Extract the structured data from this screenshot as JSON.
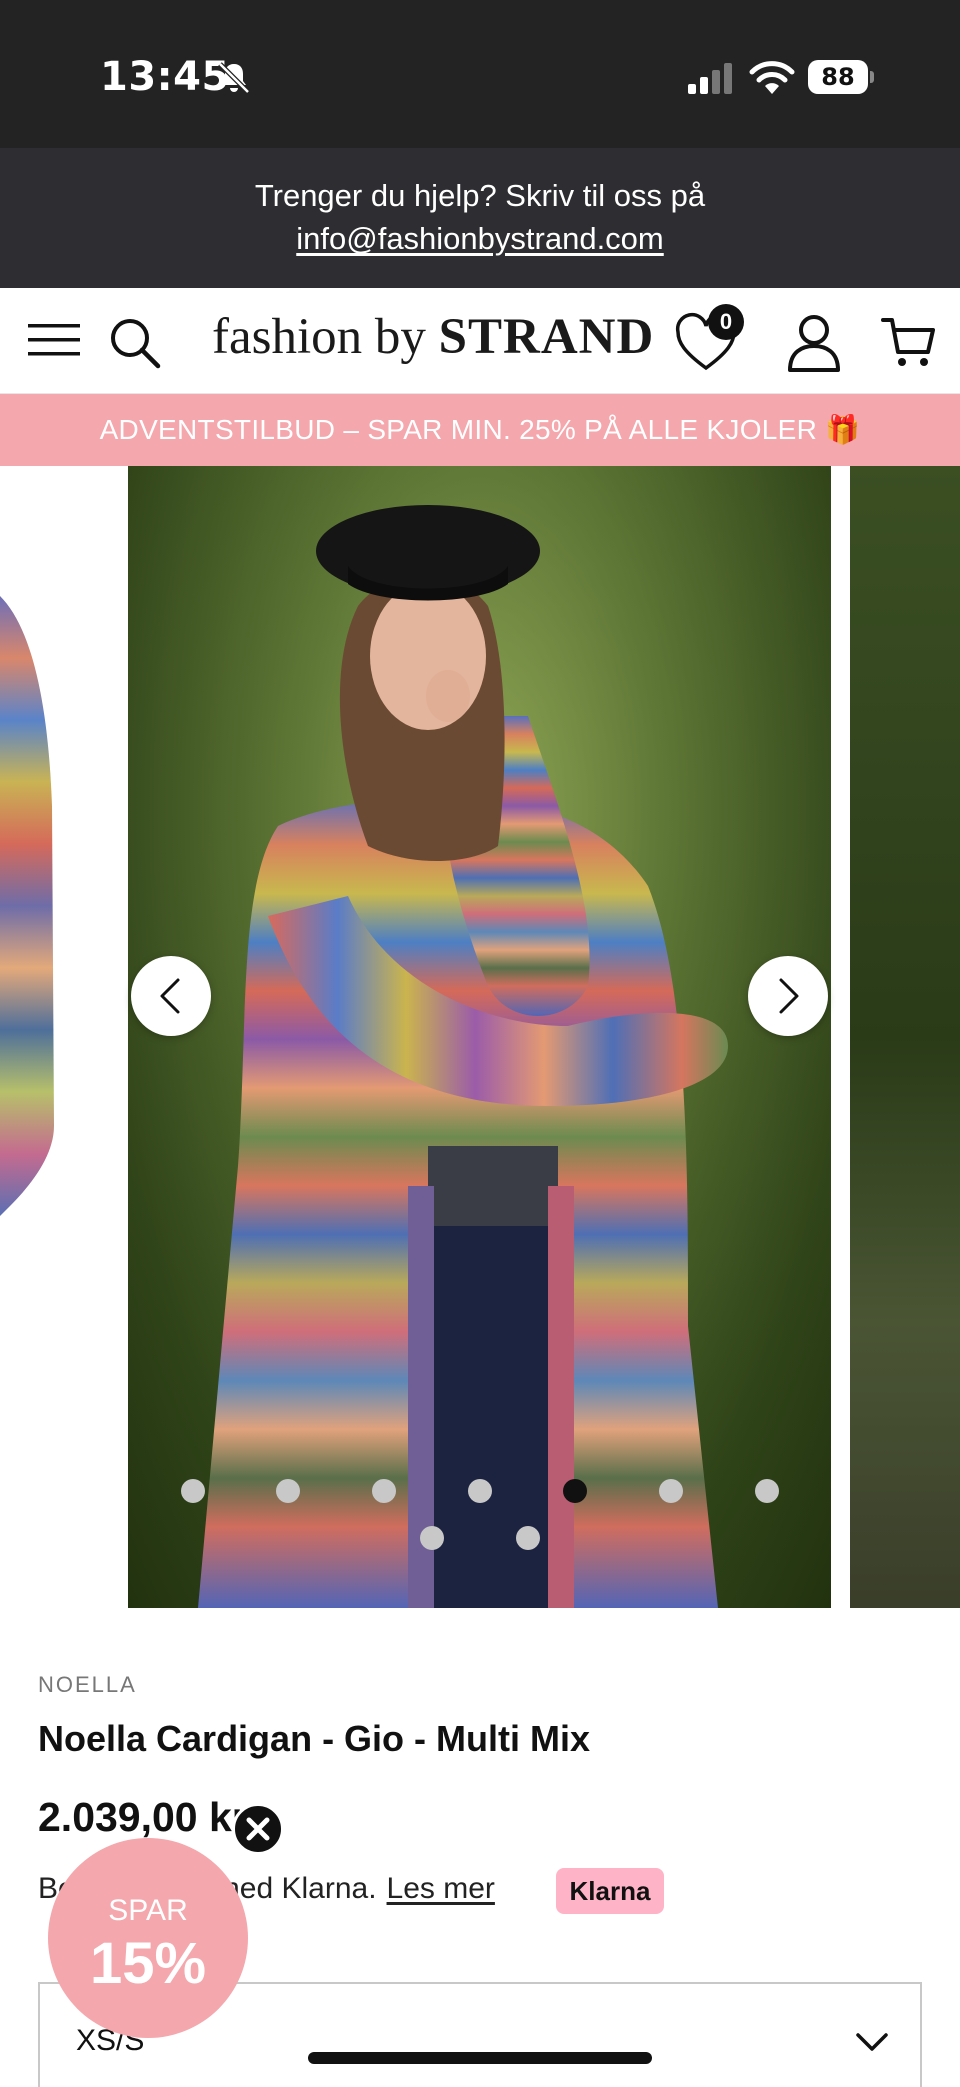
{
  "status_bar": {
    "time": "13:45",
    "battery": "88",
    "icons": [
      "bell-slash-icon",
      "signal-icon",
      "wifi-icon",
      "battery-icon"
    ]
  },
  "help_bar": {
    "text": "Trenger du hjelp? Skriv til oss på",
    "email": "info@fashionbystrand.com"
  },
  "header": {
    "logo_prefix": "fashion by ",
    "logo_brand": "STRAND",
    "wishlist_count": "0",
    "icons": [
      "menu-icon",
      "search-icon",
      "heart-icon",
      "user-icon",
      "cart-icon"
    ]
  },
  "promo": {
    "text": "ADVENTSTILBUD – SPAR MIN. 25% PÅ ALLE KJOLER 🎁"
  },
  "gallery": {
    "slide_count": 9,
    "active_index": 4,
    "icons": [
      "chevron-left-icon",
      "chevron-right-icon"
    ]
  },
  "product": {
    "brand": "NOELLA",
    "title": "Noella Cardigan - Gio - Multi Mix",
    "price": "2.039,00 kr",
    "klarna_text": "Betal senere med Klarna.",
    "klarna_link": "Les mer",
    "klarna_badge": "Klarna",
    "size_value": "XS/S"
  },
  "save_badge": {
    "label": "SPAR",
    "percent": "15%"
  },
  "colors": {
    "promo": "#f4a7ac",
    "help_bar": "#2e2d31",
    "status_bar": "#232323",
    "klarna": "#ffb3c7"
  }
}
